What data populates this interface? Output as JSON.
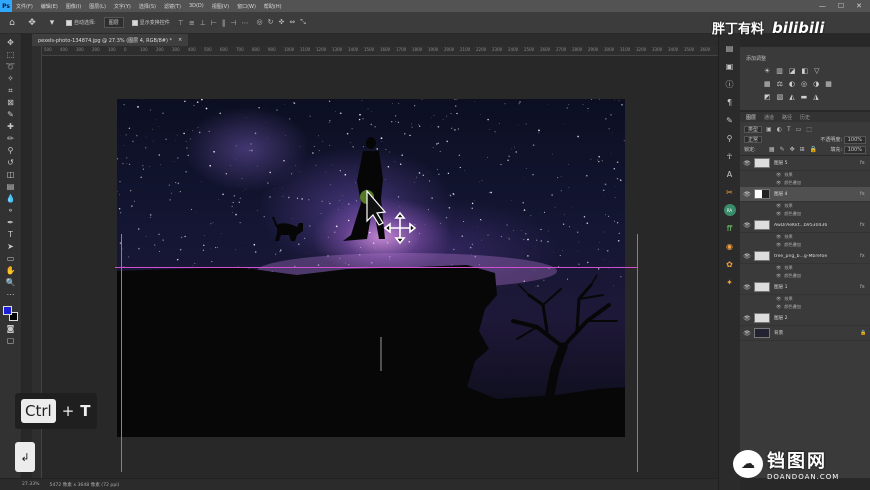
{
  "app": {
    "logo": "Ps",
    "menu": [
      "文件(F)",
      "编辑(E)",
      "图像(I)",
      "图层(L)",
      "文字(Y)",
      "选择(S)",
      "滤镜(T)",
      "3D(D)",
      "视图(V)",
      "窗口(W)",
      "帮助(H)"
    ],
    "window_controls": [
      "—",
      "☐",
      "✕"
    ]
  },
  "options_bar": {
    "auto_select_label": "自动选择:",
    "auto_select_value": "图层",
    "show_transform_label": "显示变换控件"
  },
  "document": {
    "tab_title": "pexels-photo-134874.jpg @ 27.3% (图层 4, RGB/8#) *",
    "tab_close": "×"
  },
  "ruler_top_labels": [
    "500",
    "400",
    "300",
    "200",
    "100",
    "0",
    "100",
    "200",
    "300",
    "400",
    "500",
    "600",
    "700",
    "800",
    "900",
    "1000",
    "1100",
    "1200",
    "1300",
    "1400",
    "1500",
    "1600",
    "1700",
    "1800",
    "1900",
    "2000",
    "2100",
    "2200",
    "2300",
    "2400",
    "2500",
    "2600",
    "2700",
    "2800",
    "2900",
    "3000",
    "3100",
    "3200",
    "3300",
    "3400",
    "3500",
    "3600"
  ],
  "adjustments": {
    "title": "添加调整"
  },
  "layers": {
    "tabs": [
      "图层",
      "通道",
      "路径",
      "历史"
    ],
    "filter_kind": "类型",
    "blend_mode": "正常",
    "opacity_label": "不透明度:",
    "opacity_value": "100%",
    "lock_label": "锁定:",
    "fill_label": "填充:",
    "fill_value": "100%",
    "items": [
      {
        "name": "图层 5",
        "fx": "fx",
        "effects": [
          "效果",
          "颜色叠加"
        ],
        "selected": false
      },
      {
        "name": "图层 4",
        "fx": "fx",
        "effects": [
          "效果",
          "颜色叠加"
        ],
        "selected": true
      },
      {
        "name": "AwDrAeKkt...b9530436",
        "fx": "fx",
        "effects": [
          "效果",
          "颜色叠加"
        ],
        "selected": false
      },
      {
        "name": "tree_png_b...g-Mbrefoe",
        "fx": "fx",
        "effects": [
          "效果",
          "颜色叠加"
        ],
        "selected": false
      },
      {
        "name": "图层 1",
        "fx": "fx",
        "effects": [
          "效果",
          "颜色叠加"
        ],
        "selected": false
      },
      {
        "name": "图层 2",
        "fx": "",
        "effects": [],
        "selected": false
      },
      {
        "name": "背景",
        "fx": "",
        "effects": [],
        "selected": false,
        "locked": "🔒"
      }
    ]
  },
  "shortcut": {
    "key1": "Ctrl",
    "plus": "+",
    "key2": "T",
    "enter": "↲"
  },
  "status": {
    "zoom": "27.33%",
    "doc_info": "5472 像素 x 3648 像素 (72 ppi)"
  },
  "watermarks": {
    "channel_name": "胖丁有料",
    "bilibili": "bilibili",
    "site_cn": "铛图网",
    "site_en": "DOANDOAN.COM"
  }
}
